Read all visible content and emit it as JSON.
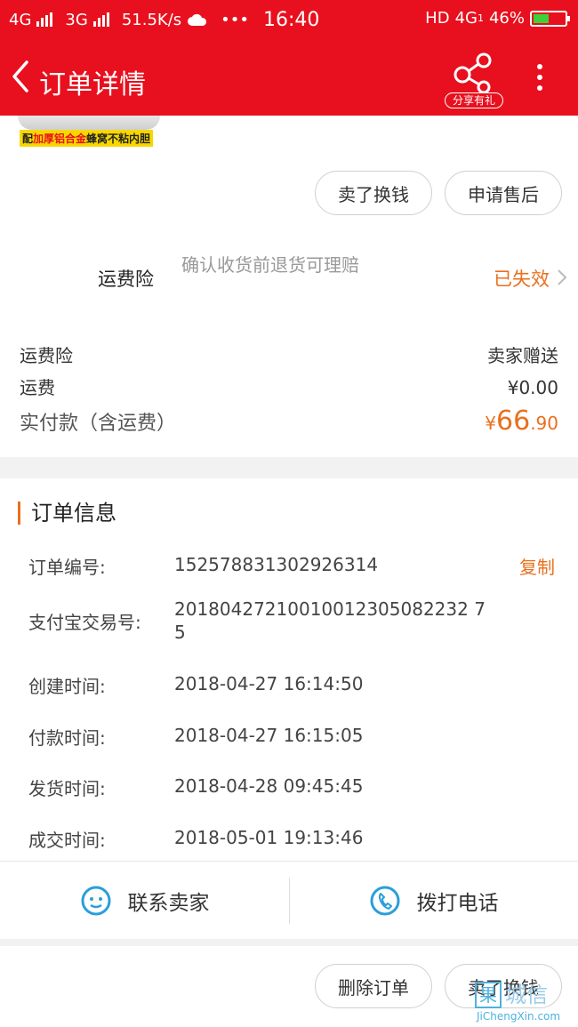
{
  "status_bar": {
    "network1": "4G",
    "network2": "3G",
    "speed": "51.5K/s",
    "more": "•••",
    "time": "16:40",
    "hd": "HD",
    "network3": "4G",
    "sim": "1",
    "battery": "46%",
    "battery_level": 0.46,
    "battery_color": "#3bd13b"
  },
  "header": {
    "title": "订单详情",
    "share_label": "分享有礼",
    "bg_color": "#e8101e"
  },
  "product": {
    "tag_prefix": "配",
    "tag_highlight": "加厚铝合金",
    "tag_suffix": "蜂窝不粘内胆"
  },
  "top_actions": {
    "sell_button": "卖了换钱",
    "after_sale_button": "申请售后"
  },
  "insurance": {
    "name": "运费险",
    "description": "确认收货前退货可理赔",
    "status": "已失效"
  },
  "fees": {
    "rows": [
      {
        "label": "运费险",
        "value": "卖家赠送"
      },
      {
        "label": "运费",
        "value": "¥0.00"
      }
    ],
    "total_label": "实付款（含运费）",
    "total_currency": "¥",
    "total_int": "66",
    "total_dec": ".90",
    "accent_color": "#e8701e"
  },
  "order_info": {
    "heading": "订单信息",
    "rows": [
      {
        "label": "订单编号:",
        "value": "152578831302926314"
      },
      {
        "label": "支付宝交易号:",
        "value": "20180427210010012305082232 75"
      },
      {
        "label": "创建时间:",
        "value": "2018-04-27 16:14:50"
      },
      {
        "label": "付款时间:",
        "value": "2018-04-27 16:15:05"
      },
      {
        "label": "发货时间:",
        "value": "2018-04-28 09:45:45"
      },
      {
        "label": "成交时间:",
        "value": "2018-05-01 19:13:46"
      }
    ],
    "copy_label": "复制"
  },
  "contact": {
    "seller_label": "联系卖家",
    "phone_label": "拨打电话"
  },
  "bottom_actions": {
    "delete_button": "删除订单",
    "sell_button": "卖了换钱"
  },
  "watermark": {
    "box": "果",
    "text": "城信",
    "url": "JiChengXin.com"
  }
}
